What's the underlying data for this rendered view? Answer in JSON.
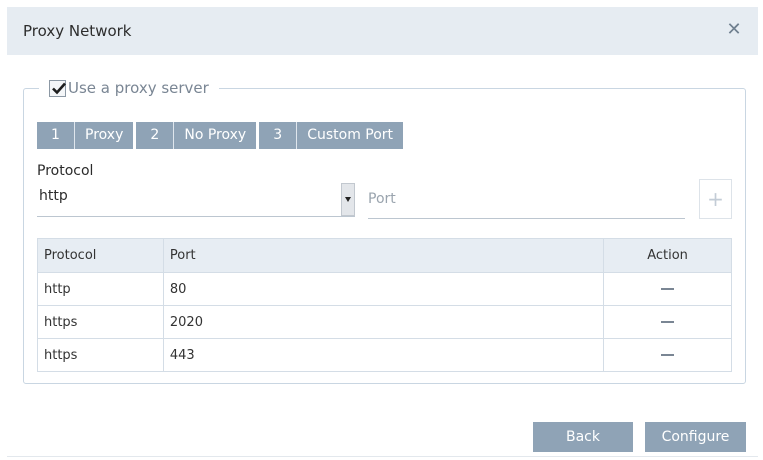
{
  "dialog": {
    "title": "Proxy Network",
    "close_icon": "close-icon"
  },
  "proxy": {
    "use_proxy_label": "Use a proxy server",
    "use_proxy_checked": true
  },
  "tabs": [
    {
      "num": "1",
      "label": "Proxy"
    },
    {
      "num": "2",
      "label": "No Proxy"
    },
    {
      "num": "3",
      "label": "Custom Port"
    }
  ],
  "form": {
    "protocol_label": "Protocol",
    "protocol_value": "http",
    "port_placeholder": "Port",
    "add_label": "+"
  },
  "table": {
    "headers": [
      "Protocol",
      "Port",
      "Action"
    ],
    "rows": [
      {
        "protocol": "http",
        "port": "80"
      },
      {
        "protocol": "https",
        "port": "2020"
      },
      {
        "protocol": "https",
        "port": "443"
      }
    ]
  },
  "buttons": {
    "back": "Back",
    "configure": "Configure"
  },
  "colors": {
    "accent": "#8fa3b6",
    "titlebar": "#e6ecf2",
    "table_header": "#e7edf3"
  }
}
